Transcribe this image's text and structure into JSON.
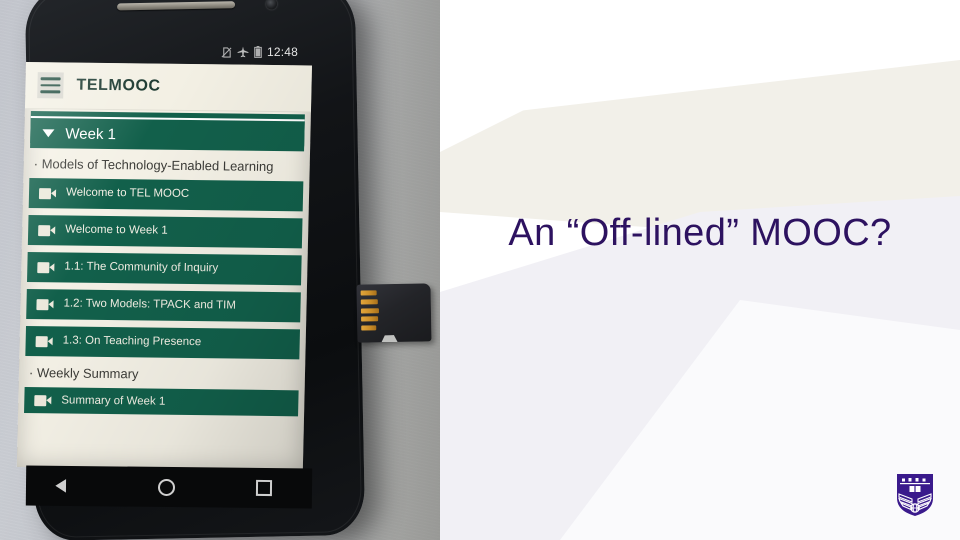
{
  "slide": {
    "title": "An “Off-lined” MOOC?",
    "title_color": "#2d1260",
    "background_color": "#ffffff"
  },
  "logo": {
    "name": "university-crest",
    "color": "#3a1a8c"
  },
  "photo": {
    "caption_subject": "smartphone and microSD card on desk",
    "surface_color": "#bfc2c8",
    "sd_card": {
      "name": "microsd-card",
      "body_color": "#232428",
      "contacts_color": "#c98c27"
    }
  },
  "phone": {
    "status_bar": {
      "clock": "12:48",
      "icons": [
        "no-sim-icon",
        "airplane-mode-icon",
        "battery-icon"
      ]
    },
    "app": {
      "menu_icon": "hamburger-menu-icon",
      "title": "TELMOOC",
      "header_bg": "#f3f0e4",
      "accent_green": "#12604b",
      "week_header": {
        "caret": "▼",
        "label": "Week 1"
      },
      "section_1": {
        "bullet": "·",
        "label": "Models of Technology-Enabled Learning"
      },
      "videos": [
        {
          "icon": "video-camera-icon",
          "label": "Welcome to TEL MOOC"
        },
        {
          "icon": "video-camera-icon",
          "label": "Welcome to Week 1"
        },
        {
          "icon": "video-camera-icon",
          "label": "1.1: The Community of Inquiry"
        },
        {
          "icon": "video-camera-icon",
          "label": "1.2: Two Models: TPACK and TIM"
        },
        {
          "icon": "video-camera-icon",
          "label": "1.3: On Teaching Presence"
        }
      ],
      "section_2": {
        "bullet": "·",
        "label": "Weekly Summary"
      },
      "partial_item": {
        "icon": "video-camera-icon",
        "label": "Summary of Week 1"
      }
    },
    "nav_bar": {
      "back": "back-button",
      "home": "home-button",
      "recents": "recents-button"
    }
  }
}
